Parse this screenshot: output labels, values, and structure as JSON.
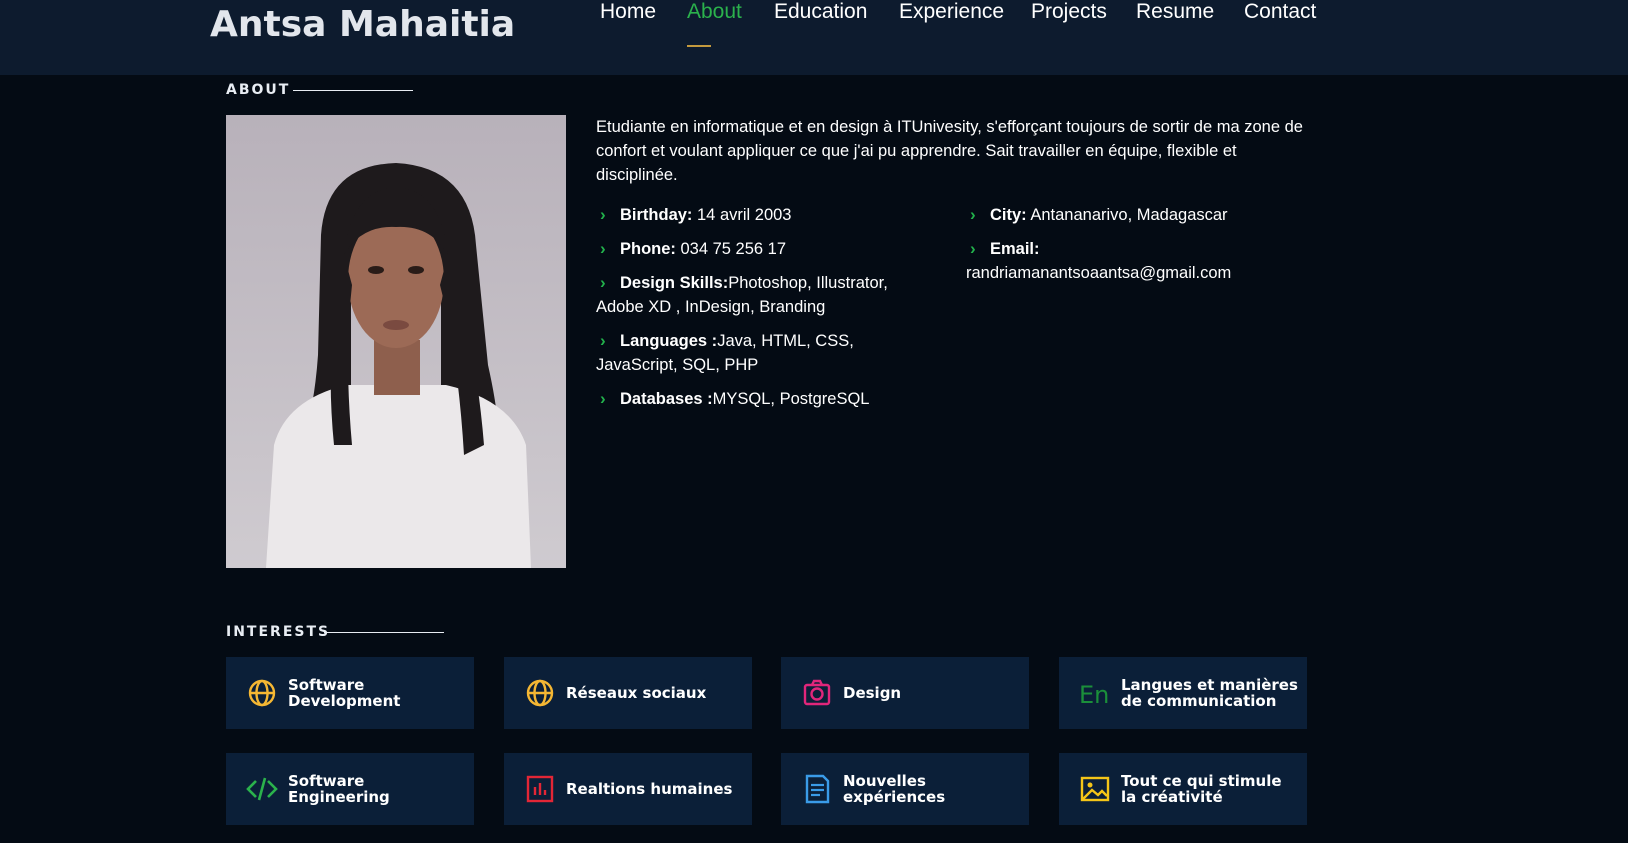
{
  "header": {
    "logo": "Antsa Mahaitia",
    "nav": [
      "Home",
      "About",
      "Education",
      "Experience",
      "Projects",
      "Resume",
      "Contact"
    ],
    "active": "About"
  },
  "about": {
    "section_title": "ABOUT",
    "bio": "Etudiante en informatique et en design à ITUnivesity, s'efforçant toujours de sortir de ma zone de confort et voulant appliquer ce que j'ai pu apprendre. Sait travailler en équipe, flexible et disciplinée.",
    "left": [
      {
        "label": "Birthday:",
        "value": " 14 avril 2003"
      },
      {
        "label": "Phone:",
        "value": " 034 75 256 17"
      },
      {
        "label": "Design Skills:",
        "value": "Photoshop, Illustrator, Adobe XD , InDesign, Branding"
      },
      {
        "label": "Languages :",
        "value": "Java, HTML, CSS, JavaScript, SQL, PHP"
      },
      {
        "label": "Databases :",
        "value": "MYSQL, PostgreSQL"
      }
    ],
    "right": [
      {
        "label": "City:",
        "value": " Antananarivo, Madagascar"
      },
      {
        "label": "Email:",
        "value": "randriamanantsoaantsa@gmail.com"
      }
    ]
  },
  "interests": {
    "section_title": "INTERESTS",
    "items": [
      {
        "label": "Software Development",
        "icon": "globe-icon",
        "color": "#f5b733"
      },
      {
        "label": "Réseaux sociaux",
        "icon": "globe-icon",
        "color": "#f5b733"
      },
      {
        "label": "Design",
        "icon": "camera-icon",
        "color": "#e1267b"
      },
      {
        "label": "Langues et manières de communication",
        "icon": "language-icon",
        "color": "#1b8f3a"
      },
      {
        "label": "Software Engineering",
        "icon": "code-icon",
        "color": "#2bb24c"
      },
      {
        "label": "Realtions humaines",
        "icon": "bar-chart-icon",
        "color": "#e32636"
      },
      {
        "label": "Nouvelles expériences",
        "icon": "document-icon",
        "color": "#3a9be8"
      },
      {
        "label": "Tout ce qui stimule la créativité",
        "icon": "image-icon",
        "color": "#f5c518"
      }
    ]
  },
  "colors": {
    "accent": "#2bb24c",
    "background": "#040b14",
    "header": "#0d1b2e",
    "card": "#0b1f38"
  }
}
